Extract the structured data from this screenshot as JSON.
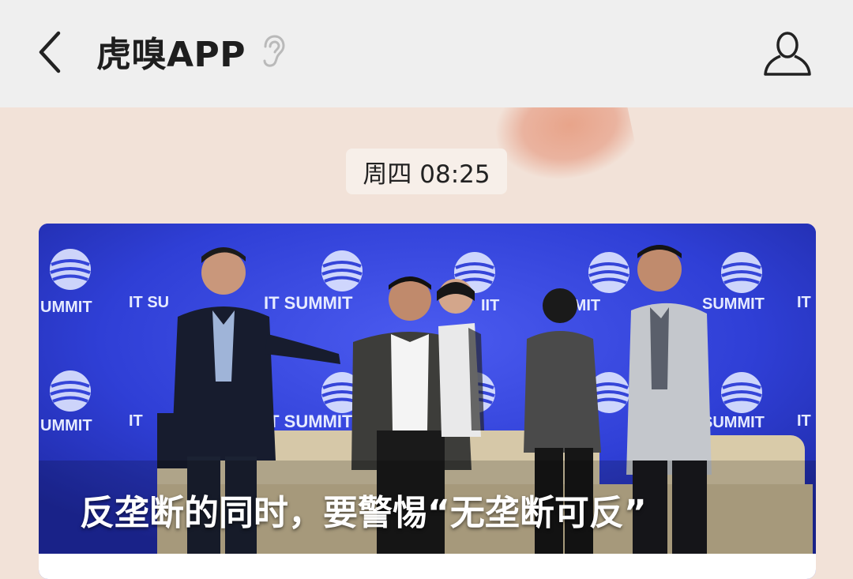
{
  "header": {
    "title": "虎嗅APP",
    "back_icon": "chevron-left-icon",
    "mute_icon": "ear-icon",
    "profile_icon": "person-icon"
  },
  "chat": {
    "timestamp": "周四 08:25",
    "article": {
      "headline": "反垄断的同时，要警惕“无垄断可反”",
      "image_backdrop_text": "IT SUMMIT"
    }
  },
  "colors": {
    "header_bg": "#efefef",
    "chat_bg": "#f2e2d8",
    "backdrop_blue": "#2a39d2"
  }
}
